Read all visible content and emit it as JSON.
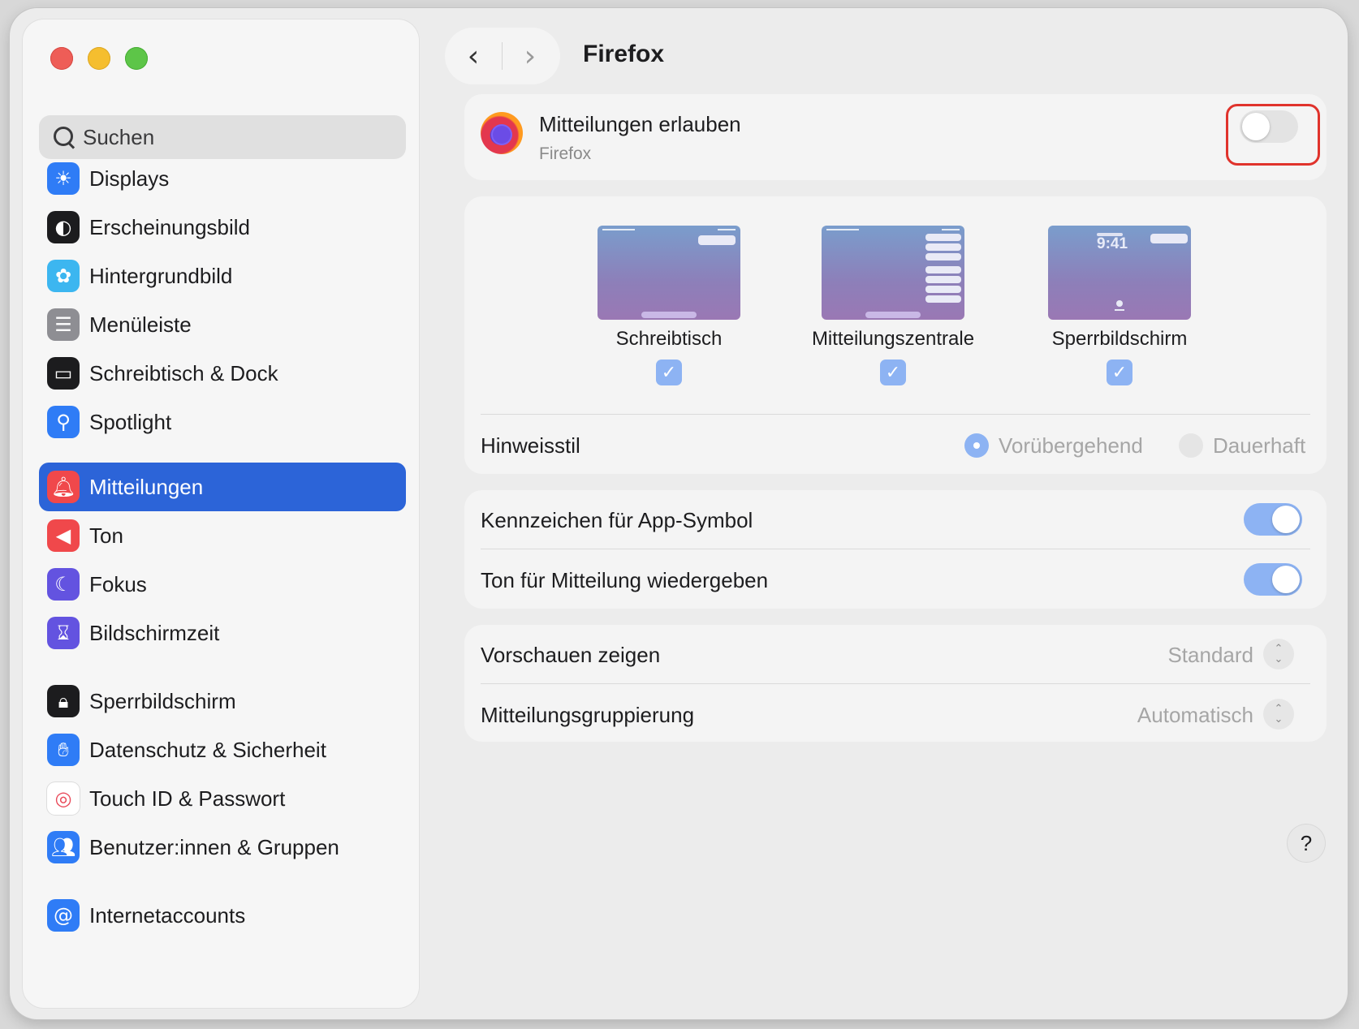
{
  "sidebar": {
    "search_placeholder": "Suchen",
    "items": [
      {
        "label": "Displays",
        "icon": "sun-icon",
        "color": "#2f7cf6"
      },
      {
        "label": "Erscheinungsbild",
        "icon": "appearance-icon",
        "color": "#1c1c1e"
      },
      {
        "label": "Hintergrundbild",
        "icon": "flower-icon",
        "color": "#3cb6f0"
      },
      {
        "label": "Menüleiste",
        "icon": "menubar-icon",
        "color": "#8e8e93"
      },
      {
        "label": "Schreibtisch & Dock",
        "icon": "dock-icon",
        "color": "#1c1c1e"
      },
      {
        "label": "Spotlight",
        "icon": "magnifier-icon",
        "color": "#2f7cf6"
      },
      {
        "label": "Mitteilungen",
        "icon": "bell-icon",
        "color": "#f0484b",
        "active": true
      },
      {
        "label": "Ton",
        "icon": "speaker-icon",
        "color": "#f0484b"
      },
      {
        "label": "Fokus",
        "icon": "moon-icon",
        "color": "#6353e0"
      },
      {
        "label": "Bildschirmzeit",
        "icon": "hourglass-icon",
        "color": "#6353e0"
      },
      {
        "label": "Sperrbildschirm",
        "icon": "lock-icon",
        "color": "#1c1c1e"
      },
      {
        "label": "Datenschutz & Sicherheit",
        "icon": "hand-icon",
        "color": "#2f7cf6"
      },
      {
        "label": "Touch ID & Passwort",
        "icon": "fingerprint-icon",
        "color": "#ffffff"
      },
      {
        "label": "Benutzer:innen & Gruppen",
        "icon": "users-icon",
        "color": "#2f7cf6"
      },
      {
        "label": "Internetaccounts",
        "icon": "at-icon",
        "color": "#2f7cf6"
      }
    ]
  },
  "header": {
    "title": "Firefox"
  },
  "allow": {
    "title": "Mitteilungen erlauben",
    "subtitle": "Firefox",
    "enabled": false
  },
  "previews": {
    "items": [
      {
        "label": "Schreibtisch",
        "checked": true
      },
      {
        "label": "Mitteilungszentrale",
        "checked": true
      },
      {
        "label": "Sperrbildschirm",
        "checked": true
      }
    ],
    "lock_time": "9:41",
    "style_label": "Hinweisstil",
    "style_options": [
      "Vorübergehend",
      "Dauerhaft"
    ],
    "style_selected": "Vorübergehend"
  },
  "toggles": [
    {
      "label": "Kennzeichen für App-Symbol",
      "on": true
    },
    {
      "label": "Ton für Mitteilung wiedergeben",
      "on": true
    }
  ],
  "selects": [
    {
      "label": "Vorschauen zeigen",
      "value": "Standard"
    },
    {
      "label": "Mitteilungsgruppierung",
      "value": "Automatisch"
    }
  ],
  "help_label": "?",
  "colors": {
    "accent": "#2c64d8",
    "toggle_on": "#8db3f3",
    "highlight": "#e0332c"
  }
}
